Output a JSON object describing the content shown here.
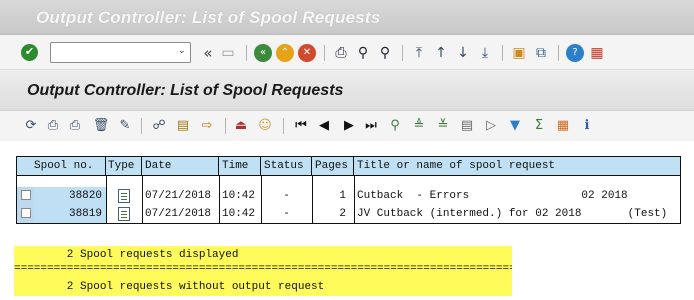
{
  "window": {
    "title": "Output Controller: List of Spool Requests"
  },
  "toolbar": {
    "command_field_value": "",
    "icons": [
      "enter-icon",
      "back-history-icon",
      "save-icon",
      "back-icon",
      "exit-icon",
      "cancel-icon",
      "print-icon",
      "find-icon",
      "find-next-icon",
      "first-page-icon",
      "previous-page-icon",
      "next-page-icon",
      "last-page-icon",
      "new-session-icon",
      "shortcut-icon",
      "help-icon",
      "customize-layout-icon"
    ]
  },
  "header": {
    "page_title": "Output Controller: List of Spool Requests"
  },
  "app_toolbar": {
    "icons": [
      "refresh-icon",
      "print-directly-icon",
      "print-with-changed-attributes-icon",
      "delete-icon",
      "edit-icon",
      "display-contents-icon",
      "details-icon",
      "forward-icon",
      "output-requests-icon",
      "owner-icon",
      "first-icon",
      "previous-icon",
      "next-icon",
      "last-icon",
      "search-icon",
      "sort-ascending-icon",
      "sort-descending-icon",
      "choose-layout-icon",
      "save-layout-icon",
      "filter-icon",
      "total-icon",
      "export-icon",
      "info-icon"
    ]
  },
  "table": {
    "headers": [
      "Spool no.",
      "Type",
      "Date",
      "Time",
      "Status",
      "Pages",
      "Title or name of spool request"
    ],
    "rows": [
      {
        "spool_no": "38820",
        "date": "07/21/2018",
        "time": "10:42",
        "status": "-",
        "pages": "1",
        "title": "Cutback  - Errors                 02 2018"
      },
      {
        "spool_no": "38819",
        "date": "07/21/2018",
        "time": "10:42",
        "status": "-",
        "pages": "2",
        "title": "JV Cutback (intermed.) for 02 2018       (Test)"
      }
    ]
  },
  "messages": {
    "line1": "        2 Spool requests displayed",
    "separator": "================================================================================",
    "line2": "        2 Spool requests without output request"
  },
  "colors": {
    "header_cell_bg": "#bfe1f3",
    "selected_cell_bg": "#bcd9ee",
    "message_bg": "#fefb5b"
  }
}
